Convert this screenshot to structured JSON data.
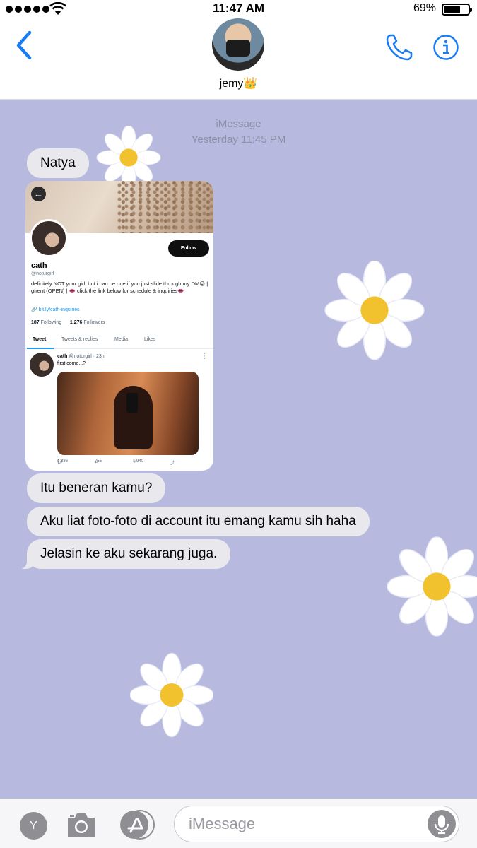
{
  "status_bar": {
    "time": "11:47 AM",
    "battery_percent": "69%",
    "battery_level": 0.69
  },
  "header": {
    "contact_name": "jemy👑",
    "back_icon": "chevron-left-icon",
    "call_icon": "phone-icon",
    "info_icon": "info-icon"
  },
  "conversation": {
    "service_label": "iMessage",
    "timestamp": "Yesterday 11:45 PM",
    "messages": [
      {
        "text": "Natya"
      },
      {
        "text": "Itu beneran kamu?"
      },
      {
        "text": "Aku liat foto-foto di account itu emang kamu sih haha"
      },
      {
        "text": "Jelasin ke aku sekarang juga."
      }
    ]
  },
  "attachment": {
    "follow_label": "Follow",
    "name": "cath",
    "handle": "@noturgirl",
    "bio": "definitely NOT your girl, but i can be one if you just slide through my DM😜 | gfrent (OPEN) | 👄 click the link below for schedule & inquiries👄",
    "link": "bit.ly/cath-inquiries",
    "following_count": "187",
    "following_label": "Following",
    "followers_count": "1,276",
    "followers_label": "Followers",
    "tabs": [
      "Tweet",
      "Tweets & replies",
      "Media",
      "Likes"
    ],
    "tweet": {
      "name": "cath",
      "handle": "@noturgirl",
      "time": "· 23h",
      "text": "first come...?",
      "replies": "1,386",
      "retweets": "755",
      "likes": "1,940"
    }
  },
  "input_bar": {
    "avatar_letter": "Y",
    "placeholder": "iMessage",
    "camera_icon": "camera-icon",
    "apps_icon": "app-store-icon",
    "mic_icon": "microphone-icon"
  },
  "colors": {
    "background": "#b7b9de",
    "bubble": "#e8e8ed",
    "accent": "#1a7cf5"
  }
}
